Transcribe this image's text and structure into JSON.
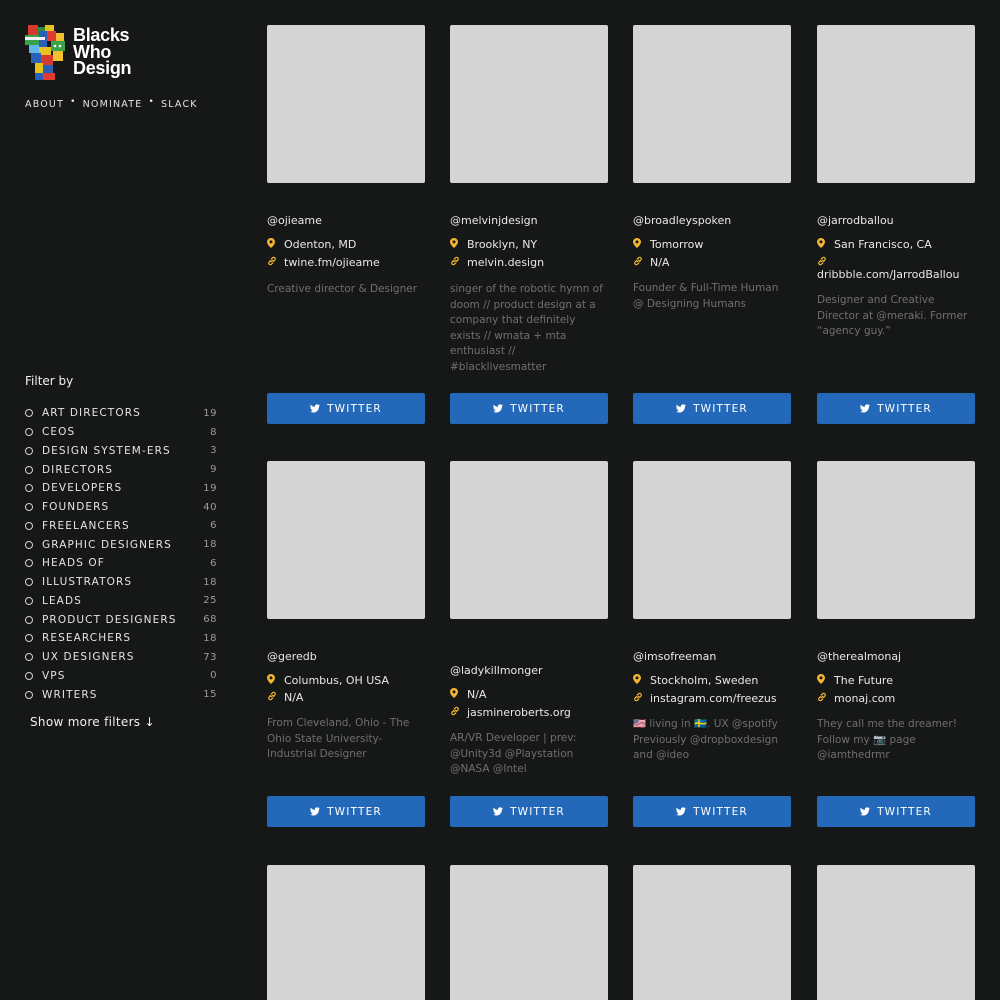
{
  "brand": {
    "line1": "Blacks",
    "line2": "Who",
    "line3": "Design"
  },
  "nav": [
    {
      "label": "ABOUT"
    },
    {
      "label": "NOMINATE"
    },
    {
      "label": "SLACK"
    }
  ],
  "nav_separator": "•",
  "filter": {
    "title": "Filter by",
    "items": [
      {
        "label": "ART DIRECTORS",
        "count": "19"
      },
      {
        "label": "CEOS",
        "count": "8"
      },
      {
        "label": "DESIGN SYSTEM-ERS",
        "count": "3"
      },
      {
        "label": "DIRECTORS",
        "count": "9"
      },
      {
        "label": "DEVELOPERS",
        "count": "19"
      },
      {
        "label": "FOUNDERS",
        "count": "40"
      },
      {
        "label": "FREELANCERS",
        "count": "6"
      },
      {
        "label": "GRAPHIC DESIGNERS",
        "count": "18"
      },
      {
        "label": "HEADS OF",
        "count": "6"
      },
      {
        "label": "ILLUSTRATORS",
        "count": "18"
      },
      {
        "label": "LEADS",
        "count": "25"
      },
      {
        "label": "PRODUCT DESIGNERS",
        "count": "68"
      },
      {
        "label": "RESEARCHERS",
        "count": "18"
      },
      {
        "label": "UX DESIGNERS",
        "count": "73"
      },
      {
        "label": "VPS",
        "count": "0"
      },
      {
        "label": "WRITERS",
        "count": "15"
      }
    ],
    "show_more": "Show more filters ↓"
  },
  "button_label": "TWITTER",
  "colors": {
    "accent": "#2469b9",
    "icon": "#f2b632",
    "background": "#161717",
    "photo": "#d4d4d4"
  },
  "cards": [
    {
      "handle": "@ojieame",
      "location": "Odenton, MD",
      "link": "twine.fm/ojieame",
      "bio": "Creative director & Designer"
    },
    {
      "handle": "@melvinjdesign",
      "location": "Brooklyn, NY",
      "link": "melvin.design",
      "bio": "singer of the robotic hymn of doom // product design at a company that definitely exists // wmata + mta enthusiast // #blacklivesmatter"
    },
    {
      "handle": "@broadleyspoken",
      "location": "Tomorrow",
      "link": "N/A",
      "bio": "Founder & Full-Time Human @ Designing Humans"
    },
    {
      "handle": "@jarrodballou",
      "location": "San Francisco, CA",
      "link": "dribbble.com/JarrodBallou",
      "bio": "Designer and Creative Director at @meraki. Former “agency guy.”"
    },
    {
      "handle": "@geredb",
      "location": "Columbus, OH USA",
      "link": "N/A",
      "bio": "From Cleveland, Ohio - The Ohio State University- Industrial Designer"
    },
    {
      "handle": "@ladykillmonger",
      "location": "N/A",
      "link": "jasmineroberts.org",
      "bio": "AR/VR Developer | prev: @Unity3d @Playstation @NASA @Intel"
    },
    {
      "handle": "@imsofreeman",
      "location": "Stockholm, Sweden",
      "link": "instagram.com/freezus",
      "bio": "🇺🇸 living in 🇸🇪. UX @spotify Previously @dropboxdesign and @ideo"
    },
    {
      "handle": "@therealmonaj",
      "location": "The Future",
      "link": "monaj.com",
      "bio": "They call me the dreamer! Follow my 📷 page @iamthedrmr"
    },
    {
      "handle": "",
      "location": "",
      "link": "",
      "bio": ""
    },
    {
      "handle": "",
      "location": "",
      "link": "",
      "bio": ""
    },
    {
      "handle": "",
      "location": "",
      "link": "",
      "bio": ""
    },
    {
      "handle": "",
      "location": "",
      "link": "",
      "bio": ""
    }
  ]
}
